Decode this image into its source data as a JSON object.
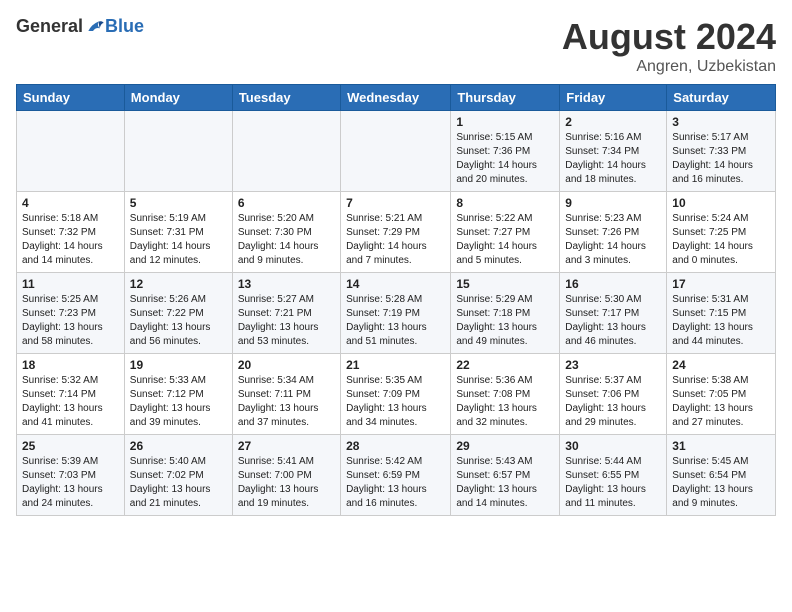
{
  "header": {
    "logo_general": "General",
    "logo_blue": "Blue",
    "month_year": "August 2024",
    "location": "Angren, Uzbekistan"
  },
  "days_of_week": [
    "Sunday",
    "Monday",
    "Tuesday",
    "Wednesday",
    "Thursday",
    "Friday",
    "Saturday"
  ],
  "weeks": [
    [
      {
        "day": "",
        "info": ""
      },
      {
        "day": "",
        "info": ""
      },
      {
        "day": "",
        "info": ""
      },
      {
        "day": "",
        "info": ""
      },
      {
        "day": "1",
        "info": "Sunrise: 5:15 AM\nSunset: 7:36 PM\nDaylight: 14 hours\nand 20 minutes."
      },
      {
        "day": "2",
        "info": "Sunrise: 5:16 AM\nSunset: 7:34 PM\nDaylight: 14 hours\nand 18 minutes."
      },
      {
        "day": "3",
        "info": "Sunrise: 5:17 AM\nSunset: 7:33 PM\nDaylight: 14 hours\nand 16 minutes."
      }
    ],
    [
      {
        "day": "4",
        "info": "Sunrise: 5:18 AM\nSunset: 7:32 PM\nDaylight: 14 hours\nand 14 minutes."
      },
      {
        "day": "5",
        "info": "Sunrise: 5:19 AM\nSunset: 7:31 PM\nDaylight: 14 hours\nand 12 minutes."
      },
      {
        "day": "6",
        "info": "Sunrise: 5:20 AM\nSunset: 7:30 PM\nDaylight: 14 hours\nand 9 minutes."
      },
      {
        "day": "7",
        "info": "Sunrise: 5:21 AM\nSunset: 7:29 PM\nDaylight: 14 hours\nand 7 minutes."
      },
      {
        "day": "8",
        "info": "Sunrise: 5:22 AM\nSunset: 7:27 PM\nDaylight: 14 hours\nand 5 minutes."
      },
      {
        "day": "9",
        "info": "Sunrise: 5:23 AM\nSunset: 7:26 PM\nDaylight: 14 hours\nand 3 minutes."
      },
      {
        "day": "10",
        "info": "Sunrise: 5:24 AM\nSunset: 7:25 PM\nDaylight: 14 hours\nand 0 minutes."
      }
    ],
    [
      {
        "day": "11",
        "info": "Sunrise: 5:25 AM\nSunset: 7:23 PM\nDaylight: 13 hours\nand 58 minutes."
      },
      {
        "day": "12",
        "info": "Sunrise: 5:26 AM\nSunset: 7:22 PM\nDaylight: 13 hours\nand 56 minutes."
      },
      {
        "day": "13",
        "info": "Sunrise: 5:27 AM\nSunset: 7:21 PM\nDaylight: 13 hours\nand 53 minutes."
      },
      {
        "day": "14",
        "info": "Sunrise: 5:28 AM\nSunset: 7:19 PM\nDaylight: 13 hours\nand 51 minutes."
      },
      {
        "day": "15",
        "info": "Sunrise: 5:29 AM\nSunset: 7:18 PM\nDaylight: 13 hours\nand 49 minutes."
      },
      {
        "day": "16",
        "info": "Sunrise: 5:30 AM\nSunset: 7:17 PM\nDaylight: 13 hours\nand 46 minutes."
      },
      {
        "day": "17",
        "info": "Sunrise: 5:31 AM\nSunset: 7:15 PM\nDaylight: 13 hours\nand 44 minutes."
      }
    ],
    [
      {
        "day": "18",
        "info": "Sunrise: 5:32 AM\nSunset: 7:14 PM\nDaylight: 13 hours\nand 41 minutes."
      },
      {
        "day": "19",
        "info": "Sunrise: 5:33 AM\nSunset: 7:12 PM\nDaylight: 13 hours\nand 39 minutes."
      },
      {
        "day": "20",
        "info": "Sunrise: 5:34 AM\nSunset: 7:11 PM\nDaylight: 13 hours\nand 37 minutes."
      },
      {
        "day": "21",
        "info": "Sunrise: 5:35 AM\nSunset: 7:09 PM\nDaylight: 13 hours\nand 34 minutes."
      },
      {
        "day": "22",
        "info": "Sunrise: 5:36 AM\nSunset: 7:08 PM\nDaylight: 13 hours\nand 32 minutes."
      },
      {
        "day": "23",
        "info": "Sunrise: 5:37 AM\nSunset: 7:06 PM\nDaylight: 13 hours\nand 29 minutes."
      },
      {
        "day": "24",
        "info": "Sunrise: 5:38 AM\nSunset: 7:05 PM\nDaylight: 13 hours\nand 27 minutes."
      }
    ],
    [
      {
        "day": "25",
        "info": "Sunrise: 5:39 AM\nSunset: 7:03 PM\nDaylight: 13 hours\nand 24 minutes."
      },
      {
        "day": "26",
        "info": "Sunrise: 5:40 AM\nSunset: 7:02 PM\nDaylight: 13 hours\nand 21 minutes."
      },
      {
        "day": "27",
        "info": "Sunrise: 5:41 AM\nSunset: 7:00 PM\nDaylight: 13 hours\nand 19 minutes."
      },
      {
        "day": "28",
        "info": "Sunrise: 5:42 AM\nSunset: 6:59 PM\nDaylight: 13 hours\nand 16 minutes."
      },
      {
        "day": "29",
        "info": "Sunrise: 5:43 AM\nSunset: 6:57 PM\nDaylight: 13 hours\nand 14 minutes."
      },
      {
        "day": "30",
        "info": "Sunrise: 5:44 AM\nSunset: 6:55 PM\nDaylight: 13 hours\nand 11 minutes."
      },
      {
        "day": "31",
        "info": "Sunrise: 5:45 AM\nSunset: 6:54 PM\nDaylight: 13 hours\nand 9 minutes."
      }
    ]
  ]
}
